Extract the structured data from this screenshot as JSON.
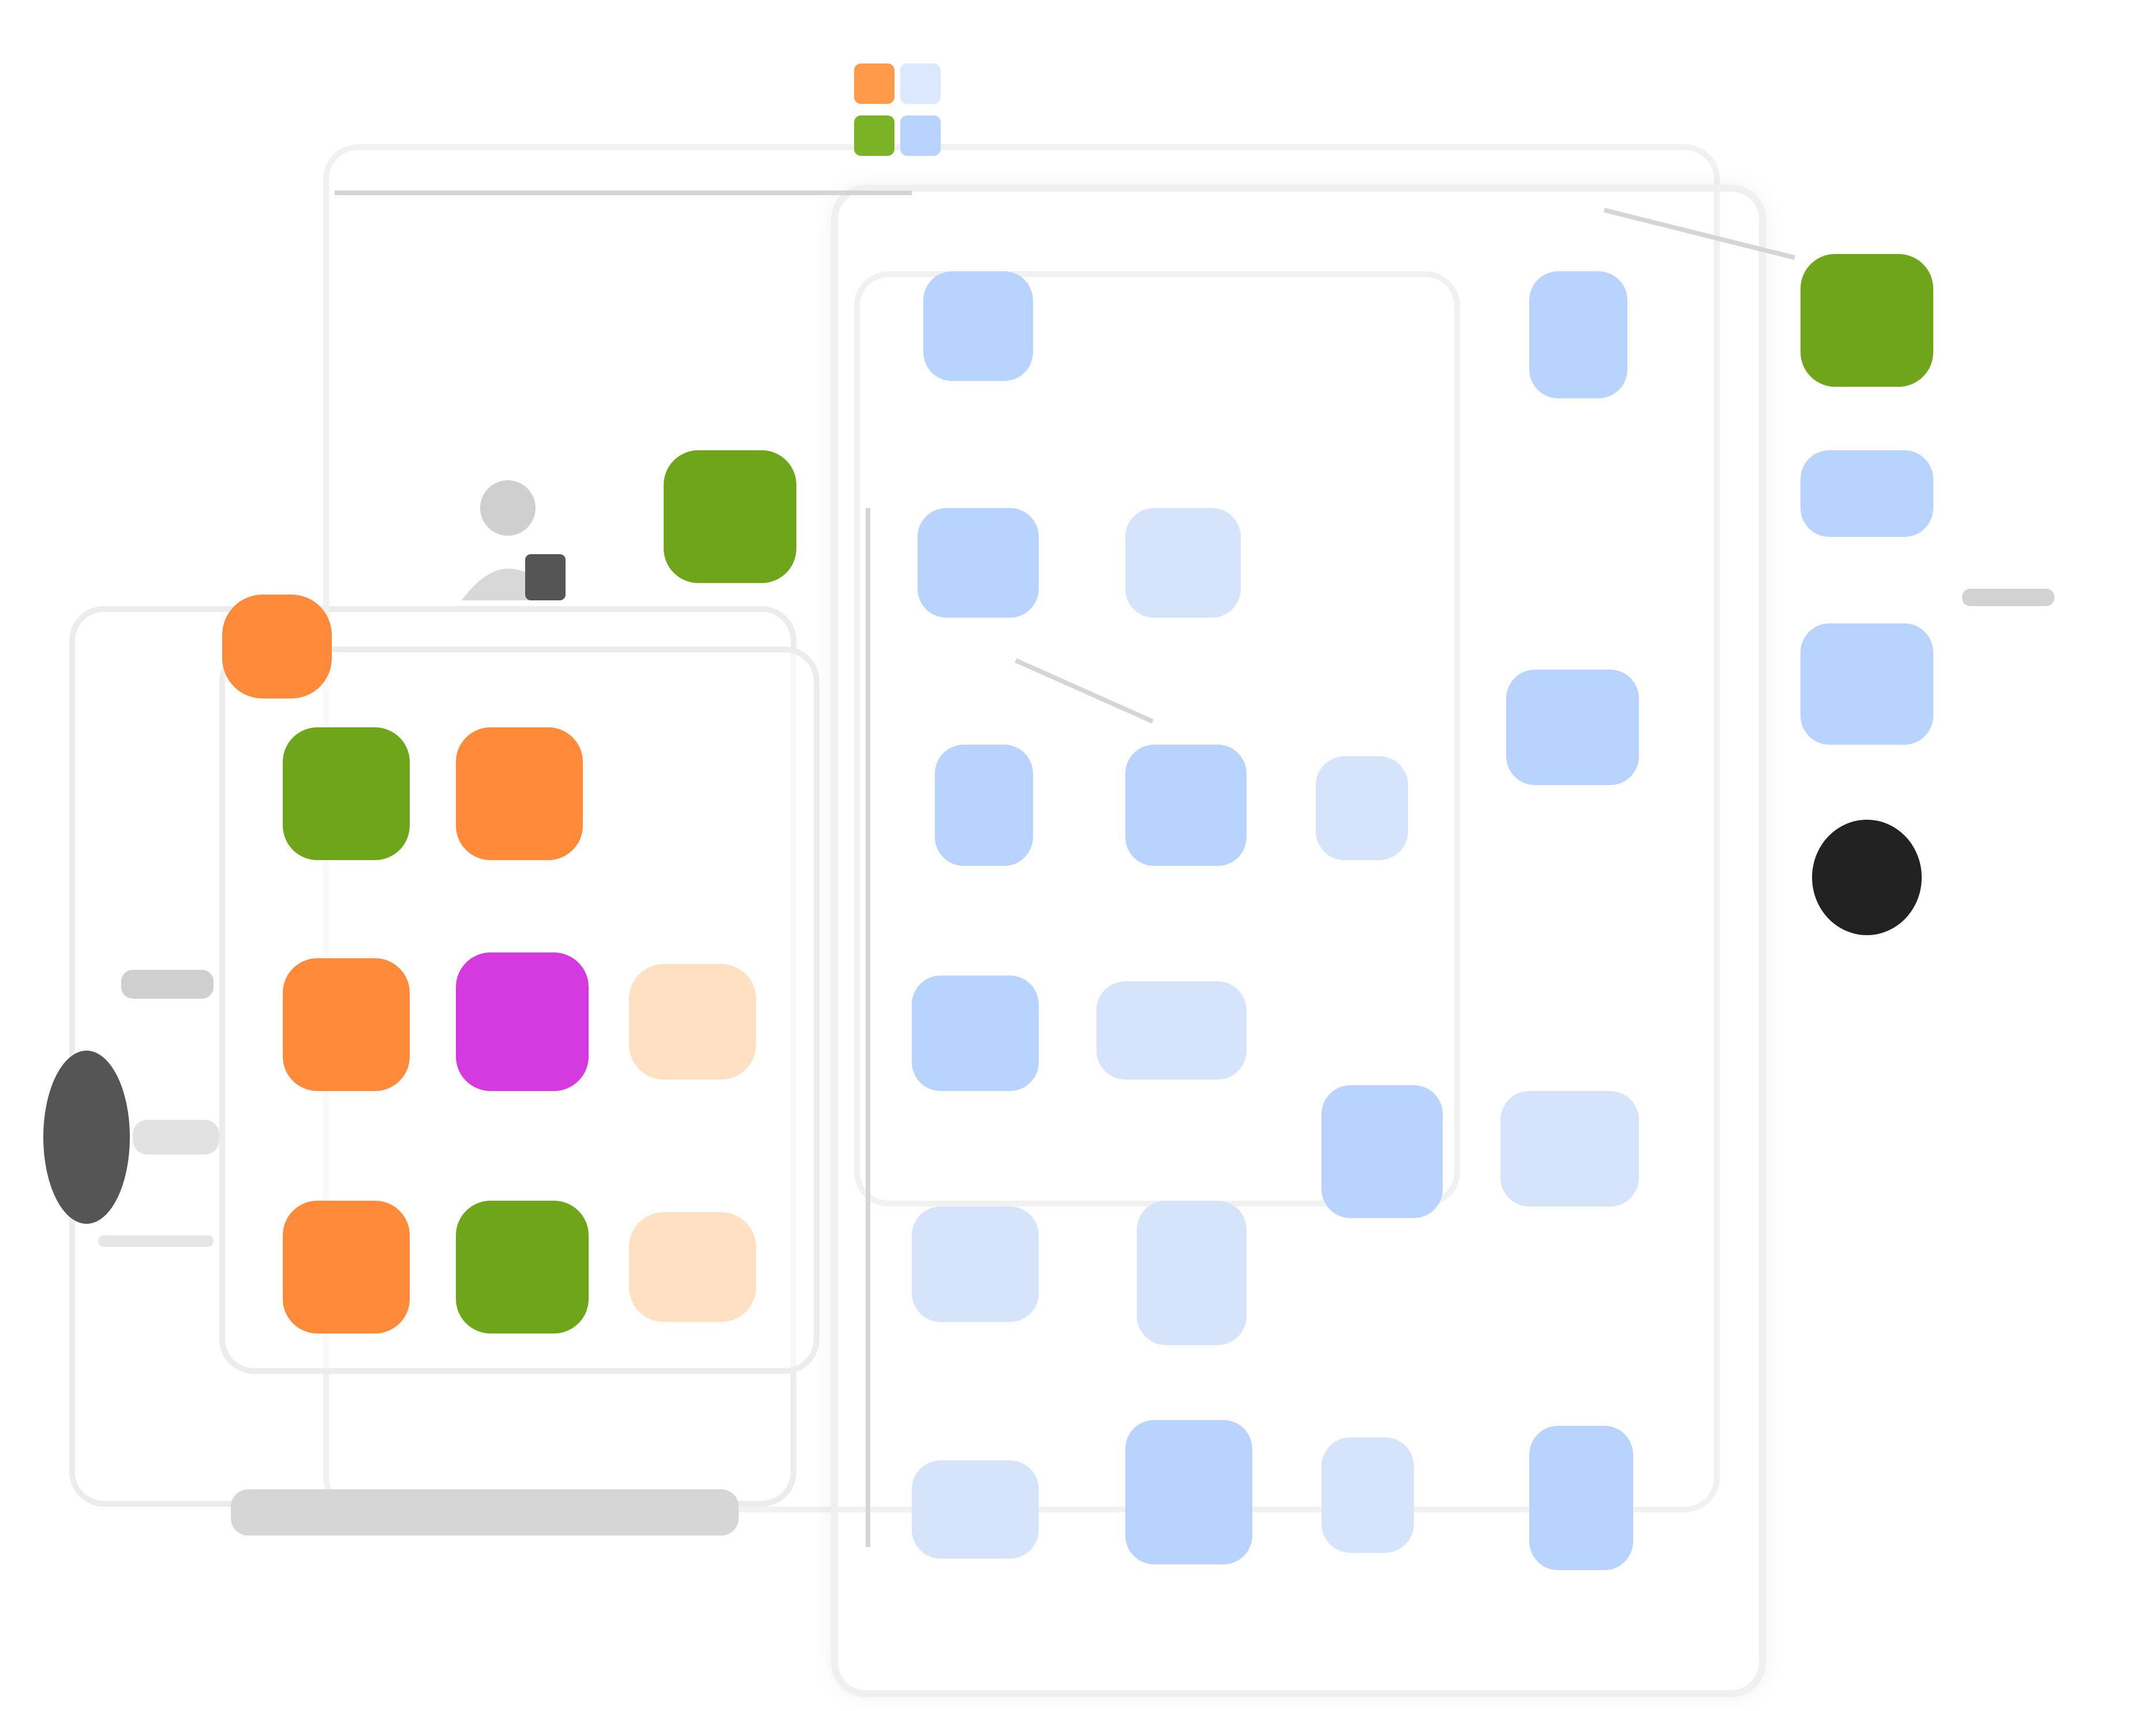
{
  "diagram": {
    "colors": {
      "green": "#6fa51a",
      "orange": "#ff8a3a",
      "peach": "#ffe0c2",
      "purple": "#d43ae0",
      "blue": "#b9d3ff",
      "dark": "#222222"
    },
    "icons": {
      "top_logo": "pinwheel-logo-icon",
      "user": "user-icon",
      "search": "search-icon"
    }
  }
}
